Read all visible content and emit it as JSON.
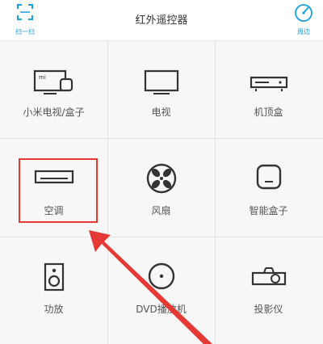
{
  "header": {
    "title": "红外遥控器",
    "scan_label": "扫一扫",
    "nearby_label": "周边"
  },
  "devices": [
    {
      "label": "小米电视/盒子",
      "icon": "mi-tv-box-icon"
    },
    {
      "label": "电视",
      "icon": "tv-icon"
    },
    {
      "label": "机顶盒",
      "icon": "set-top-box-icon"
    },
    {
      "label": "空调",
      "icon": "air-conditioner-icon"
    },
    {
      "label": "风扇",
      "icon": "fan-icon"
    },
    {
      "label": "智能盒子",
      "icon": "smart-box-icon"
    },
    {
      "label": "功放",
      "icon": "amplifier-icon"
    },
    {
      "label": "DVD播放机",
      "icon": "dvd-player-icon"
    },
    {
      "label": "投影仪",
      "icon": "projector-icon"
    }
  ],
  "colors": {
    "accent": "#1a9fe0",
    "highlight": "#e53935",
    "icon": "#333333"
  }
}
